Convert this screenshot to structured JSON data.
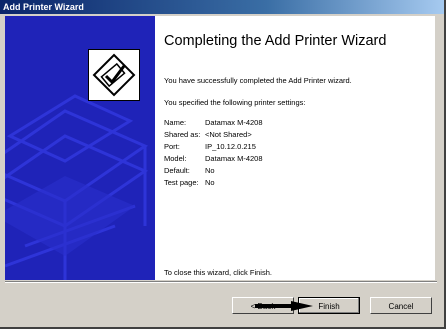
{
  "window": {
    "title": "Add Printer Wizard"
  },
  "content": {
    "heading": "Completing the Add Printer Wizard",
    "success_text": "You have successfully completed the Add Printer wizard.",
    "specified_text": "You specified the following printer settings:",
    "settings": [
      {
        "label": "Name:",
        "value": "Datamax M-4208"
      },
      {
        "label": "Shared as:",
        "value": "<Not Shared>"
      },
      {
        "label": "Port:",
        "value": "IP_10.12.0.215"
      },
      {
        "label": "Model:",
        "value": "Datamax M-4208"
      },
      {
        "label": "Default:",
        "value": "No"
      },
      {
        "label": "Test page:",
        "value": "No"
      }
    ],
    "close_text": "To close this wizard, click Finish."
  },
  "buttons": {
    "back": "< Back",
    "finish": "Finish",
    "cancel": "Cancel"
  },
  "icons": {
    "wizard": "printer-checkmark-icon",
    "pointer": "arrow-pointer-icon"
  },
  "colors": {
    "title_bar": "#0a246a",
    "left_panel": "#1f23b8",
    "dialog": "#d4d0c8"
  }
}
